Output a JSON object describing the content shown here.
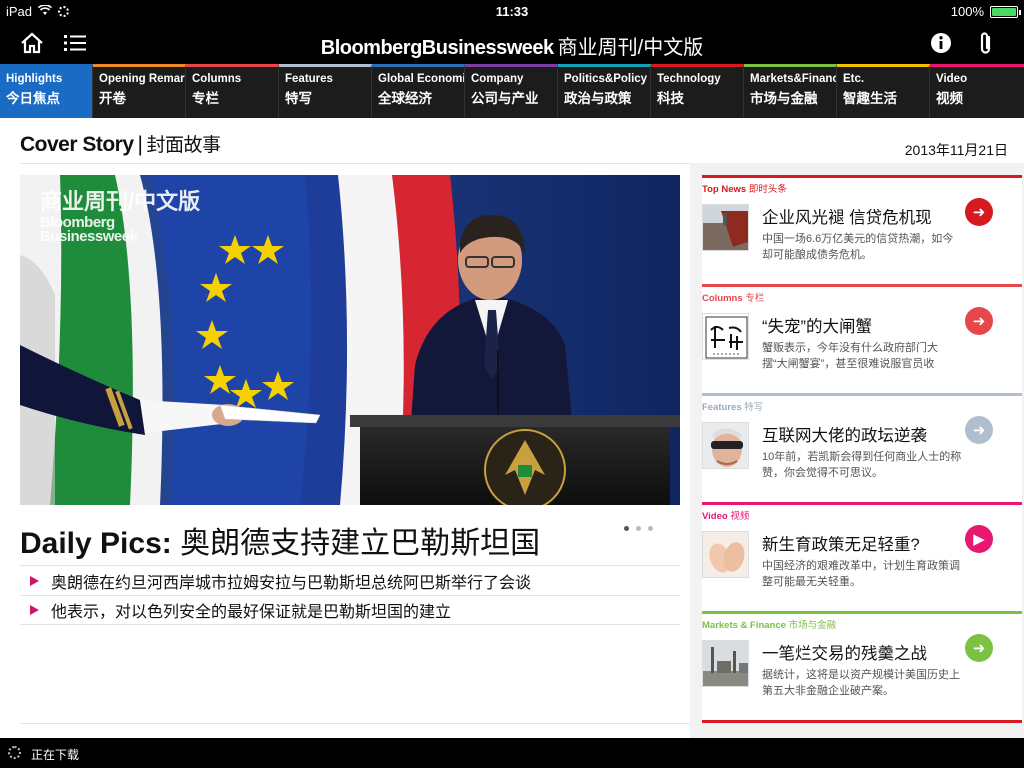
{
  "status_bar": {
    "device": "iPad",
    "time": "11:33",
    "battery": "100%",
    "battery_level": 1.0
  },
  "header": {
    "brand_en": "BloombergBusinessweek",
    "brand_cn": "商业周刊/中文版"
  },
  "nav": {
    "tabs": [
      {
        "en": "Highlights",
        "cn": "今日焦点",
        "color": "#1a6bc4",
        "active": true
      },
      {
        "en": "Opening Remarks",
        "cn": "开卷",
        "color": "#f08a24"
      },
      {
        "en": "Columns",
        "cn": "专栏",
        "color": "#e5474b"
      },
      {
        "en": "Features",
        "cn": "特写",
        "color": "#b0bfcf"
      },
      {
        "en": "Global Economics",
        "cn": "全球经济",
        "color": "#2f6db5"
      },
      {
        "en": "Company",
        "cn": "公司与产业",
        "color": "#7b3fa0"
      },
      {
        "en": "Politics&Policy",
        "cn": "政治与政策",
        "color": "#14a3b4"
      },
      {
        "en": "Technology",
        "cn": "科技",
        "color": "#d71920"
      },
      {
        "en": "Markets&Finance",
        "cn": "市场与金融",
        "color": "#7cc142"
      },
      {
        "en": "Etc.",
        "cn": "智趣生活",
        "color": "#f6c200"
      },
      {
        "en": "Video",
        "cn": "视频",
        "color": "#e8176f"
      }
    ]
  },
  "cover": {
    "label_en": "Cover Story",
    "separator": "|",
    "label_cn": "封面故事",
    "date": "2013年11月21日"
  },
  "hero": {
    "watermark_cn": "商业周刊/中文版",
    "watermark_en": "Bloomberg Businessweek"
  },
  "daily_pics": {
    "label": "Daily Pics:",
    "title": "奥朗德支持建立巴勒斯坦国",
    "bullets": [
      "奥朗德在约旦河西岸城市拉姆安拉与巴勒斯坦总统阿巴斯举行了会谈",
      "他表示，对以色列安全的最好保证就是巴勒斯坦国的建立"
    ],
    "page_count": 3,
    "current_page": 1
  },
  "news": [
    {
      "section": "Top News",
      "section_cn": "即时头条",
      "color": "#d71920",
      "title": "企业风光褪 信贷危机现",
      "desc": "中国一场6.6万亿美元的信贷热潮，如今却可能酿成债务危机。",
      "thumb": "ship-thumb"
    },
    {
      "section": "Columns",
      "section_cn": "专栏",
      "color": "#e5474b",
      "title": "“失宠”的大闸蟹",
      "desc": "蟹贩表示，今年没有什么政府部门大摆“大闸蟹宴”，甚至很难说服官员收",
      "thumb": "calligraphy-thumb"
    },
    {
      "section": "Features",
      "section_cn": "特写",
      "color": "#b0bfcf",
      "title": "互联网大佬的政坛逆袭",
      "desc": "10年前，若凯斯会得到任何商业人士的称赞，你会觉得不可思议。",
      "thumb": "portrait-thumb"
    },
    {
      "section": "Video",
      "section_cn": "视频",
      "color": "#e8176f",
      "title": "新生育政策无足轻重?",
      "desc": "中国经济的艰难改革中，计划生育政策调整可能最无关轻重。",
      "thumb": "baby-feet-thumb"
    },
    {
      "section": "Markets & Finance",
      "section_cn": "市场与金融",
      "color": "#7cc142",
      "title": "一笔烂交易的残羹之战",
      "desc": "据统计，这将是以资产规模计美国历史上第五大非金融企业破产案。",
      "thumb": "factory-thumb"
    }
  ],
  "footer": {
    "status": "正在下载"
  }
}
